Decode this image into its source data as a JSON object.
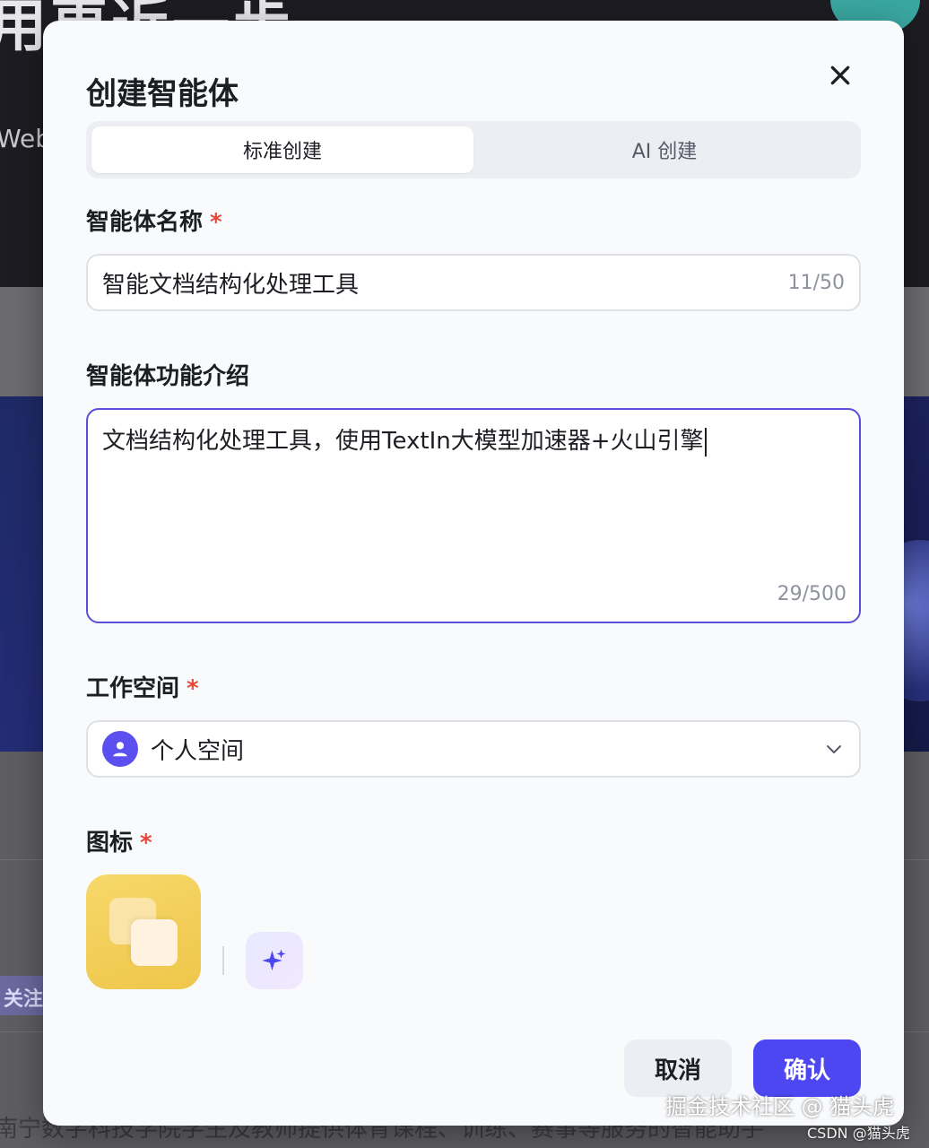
{
  "background": {
    "hero_title": "用更近一步",
    "hero_sub": "WebS",
    "follow_label": "关注",
    "footer_text": "南宁数字科技学院学生及教师提供体育课程、训练、赛事等服务的智能助手"
  },
  "modal": {
    "title": "创建智能体",
    "close_icon": "close-icon",
    "tabs": [
      {
        "label": "标准创建",
        "active": true
      },
      {
        "label": "AI 创建",
        "active": false
      }
    ],
    "name_field": {
      "label": "智能体名称",
      "required_mark": "*",
      "value": "智能文档结构化处理工具",
      "counter": "11/50"
    },
    "desc_field": {
      "label": "智能体功能介绍",
      "value": "文档结构化处理工具，使用TextIn大模型加速器+火山引擎",
      "counter": "29/500"
    },
    "workspace_field": {
      "label": "工作空间",
      "required_mark": "*",
      "value": "个人空间"
    },
    "icon_field": {
      "label": "图标",
      "required_mark": "*"
    },
    "buttons": {
      "cancel": "取消",
      "confirm": "确认"
    }
  },
  "watermark": {
    "main": "掘金技术社区 @ 猫头虎",
    "sub": "CSDN @猫头虎"
  },
  "colors": {
    "accent": "#4d47f2",
    "focus_border": "#5a4fd8",
    "required": "#e5483a",
    "icon_tile": "#f2cd55"
  }
}
